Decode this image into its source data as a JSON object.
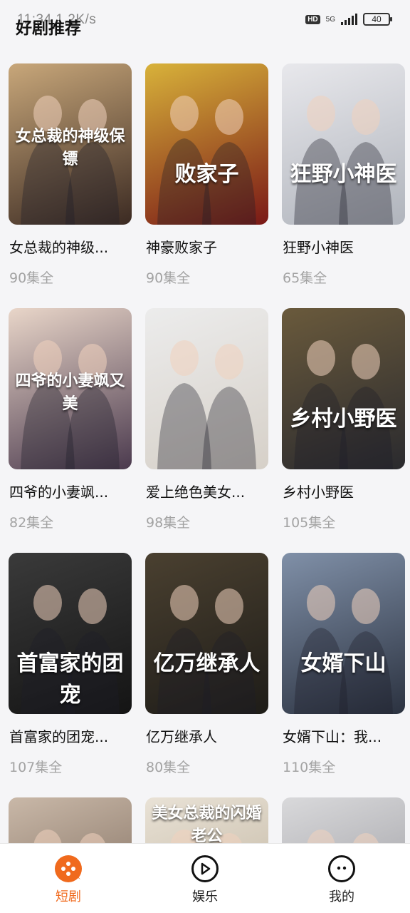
{
  "status_bar": {
    "left_text": "11:34  1.2K/s",
    "network": "5G",
    "battery": "40"
  },
  "header": {
    "title": "好剧推荐"
  },
  "dramas": [
    {
      "title": "女总裁的神级...",
      "episodes": "90集全",
      "poster_text": "女总裁的神级保镖",
      "bg": [
        "#c8a77a",
        "#3b2a22"
      ]
    },
    {
      "title": "神豪败家子",
      "episodes": "90集全",
      "poster_text": "败家子",
      "bg": [
        "#d8b23a",
        "#7a1816"
      ]
    },
    {
      "title": "狂野小神医",
      "episodes": "65集全",
      "poster_text": "狂野小神医",
      "bg": [
        "#e8e8ec",
        "#b0b4bc"
      ]
    },
    {
      "title": "四爷的小妻飒...",
      "episodes": "82集全",
      "poster_text": "四爷的小妻飒又美",
      "bg": [
        "#e9d6c9",
        "#4b3a4e"
      ]
    },
    {
      "title": "爱上绝色美女...",
      "episodes": "98集全",
      "poster_text": "",
      "bg": [
        "#ececec",
        "#d6d0c8"
      ]
    },
    {
      "title": "乡村小野医",
      "episodes": "105集全",
      "poster_text": "乡村小野医",
      "bg": [
        "#6a5a3c",
        "#2a2a2e"
      ]
    },
    {
      "title": "首富家的团宠...",
      "episodes": "107集全",
      "poster_text": "首富家的团宠",
      "bg": [
        "#3a3a3a",
        "#141414"
      ]
    },
    {
      "title": "亿万继承人",
      "episodes": "80集全",
      "poster_text": "亿万继承人",
      "bg": [
        "#4a4030",
        "#1e1c18"
      ]
    },
    {
      "title": "女婿下山：我...",
      "episodes": "110集全",
      "poster_text": "女婿下山",
      "bg": [
        "#8090a8",
        "#2b3240"
      ]
    },
    {
      "title": "",
      "episodes": "",
      "poster_text": "",
      "bg": [
        "#c9b8a8",
        "#6d5a4c"
      ]
    },
    {
      "title": "",
      "episodes": "",
      "poster_text": "美女总裁的闪婚老公",
      "bg": [
        "#e9e2d6",
        "#b7aa94"
      ]
    },
    {
      "title": "",
      "episodes": "",
      "poster_text": "",
      "bg": [
        "#d9d9db",
        "#8e8e94"
      ]
    }
  ],
  "tabbar": {
    "tabs": [
      {
        "label": "短剧",
        "icon": "drama-icon",
        "active": true
      },
      {
        "label": "娱乐",
        "icon": "play-icon",
        "active": false
      },
      {
        "label": "我的",
        "icon": "profile-icon",
        "active": false
      }
    ],
    "accent": "#f06a1d"
  }
}
